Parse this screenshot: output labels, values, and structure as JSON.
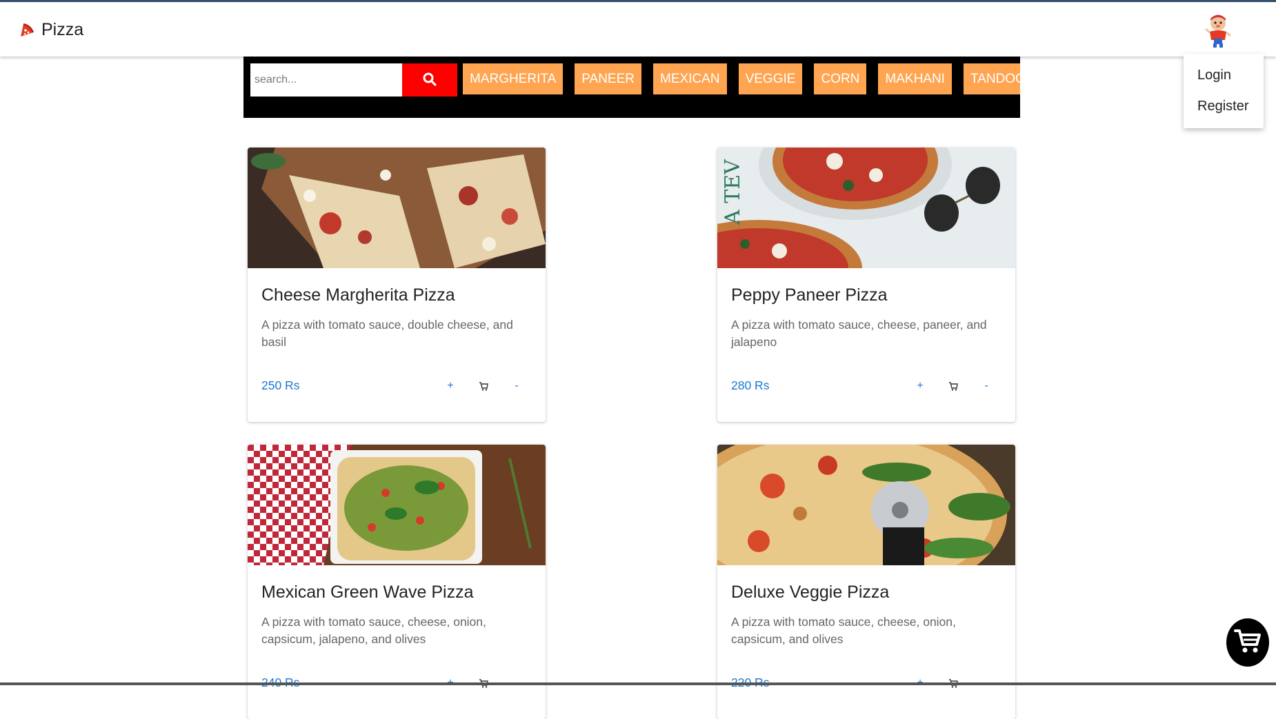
{
  "app": {
    "title": "Pizza",
    "logo_icon": "pizza-slice-icon"
  },
  "user_menu": {
    "avatar_icon": "user-avatar-icon",
    "items": [
      "Login",
      "Register"
    ]
  },
  "search": {
    "placeholder": "search...",
    "button_icon": "search-icon"
  },
  "categories": [
    "MARGHERITA",
    "PANEER",
    "MEXICAN",
    "VEGGIE",
    "CORN",
    "MAKHANI",
    "TANDOORI"
  ],
  "products": [
    {
      "name": "Cheese Margherita Pizza",
      "description": "A pizza with tomato sauce, double cheese, and basil",
      "price": "250 Rs",
      "add_label": "+",
      "remove_label": "-"
    },
    {
      "name": "Peppy Paneer Pizza",
      "description": "A pizza with tomato sauce, cheese, paneer, and jalapeno",
      "price": "280 Rs",
      "add_label": "+",
      "remove_label": "-"
    },
    {
      "name": "Mexican Green Wave Pizza",
      "description": "A pizza with tomato sauce, cheese, onion, capsicum, jalapeno, and olives",
      "price": "240 Rs",
      "add_label": "+",
      "remove_label": "-"
    },
    {
      "name": "Deluxe Veggie Pizza",
      "description": "A pizza with tomato sauce, cheese, onion, capsicum, and olives",
      "price": "220 Rs",
      "add_label": "+",
      "remove_label": "-"
    }
  ],
  "colors": {
    "category_bg": "#ffa552",
    "search_button": "#ff0000",
    "price": "#1976d2",
    "toolbar_bg": "#000000"
  },
  "floating_cart": {
    "icon": "shopping-cart-icon"
  }
}
